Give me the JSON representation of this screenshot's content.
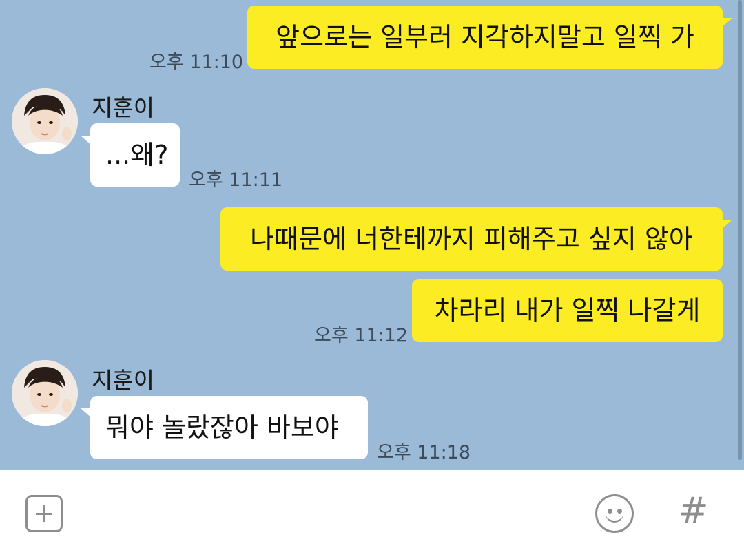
{
  "messages": [
    {
      "type": "sent",
      "text": "앞으로는 일부러 지각하지말고 일찍 가",
      "time": "오후 11:10"
    },
    {
      "type": "received",
      "sender": "지훈이",
      "text": "...왜?",
      "time": "오후 11:11"
    },
    {
      "type": "sent",
      "text": "나때문에 너한테까지 피해주고 싶지 않아",
      "time": ""
    },
    {
      "type": "sent",
      "text": "차라리 내가 일찍 나갈게",
      "time": "오후 11:12"
    },
    {
      "type": "received",
      "sender": "지훈이",
      "text": "뭐야 놀랐잖아 바보야",
      "time": "오후 11:18"
    }
  ],
  "input_bar": {
    "icons": [
      "plus-icon",
      "emoji-icon",
      "hash-icon"
    ],
    "hash_glyph": "#"
  },
  "colors": {
    "background": "#9bbad8",
    "sent_bubble": "#fcec24",
    "received_bubble": "#ffffff"
  }
}
